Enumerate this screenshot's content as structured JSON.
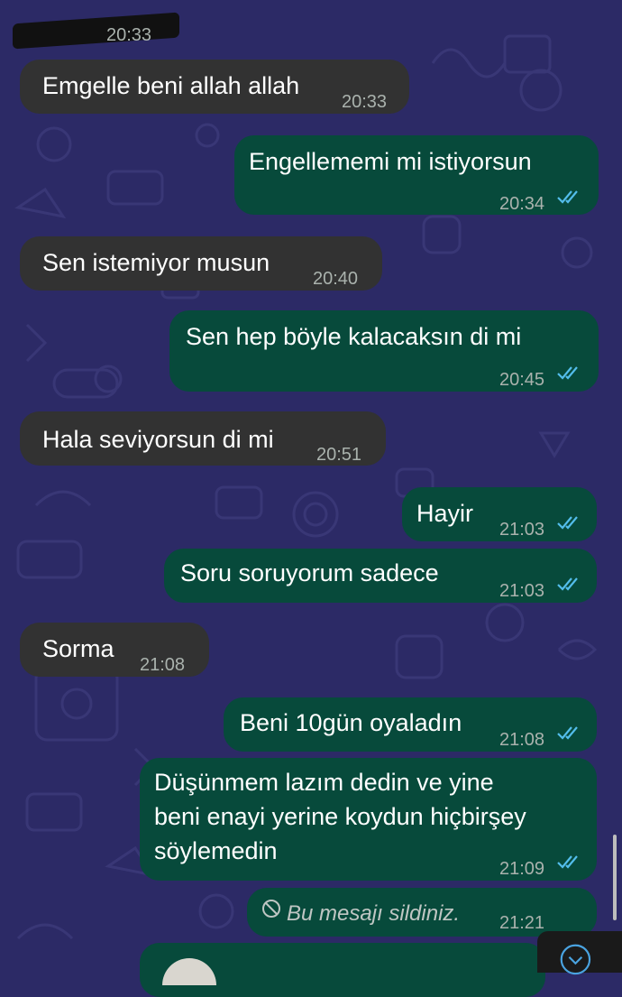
{
  "colors": {
    "wallpaper": "#2c2a66",
    "incoming_bubble": "#323232",
    "outgoing_bubble": "#074a3b",
    "read_ticks": "#53bdeb",
    "timestamp": "#aab2ad"
  },
  "top_partial": {
    "time": "20:33"
  },
  "messages": [
    {
      "dir": "in",
      "text": "Emgelle beni allah allah",
      "time": "20:33"
    },
    {
      "dir": "out",
      "text": "Engellememi mi istiyorsun",
      "time": "20:34",
      "status": "read"
    },
    {
      "dir": "in",
      "text": "Sen istemiyor musun",
      "time": "20:40"
    },
    {
      "dir": "out",
      "text": "Sen hep böyle kalacaksın di mi",
      "time": "20:45",
      "status": "read"
    },
    {
      "dir": "in",
      "text": "Hala seviyorsun di mi",
      "time": "20:51"
    },
    {
      "dir": "out",
      "text": "Hayir",
      "time": "21:03",
      "status": "read"
    },
    {
      "dir": "out",
      "text": "Soru soruyorum sadece",
      "time": "21:03",
      "status": "read"
    },
    {
      "dir": "in",
      "text": "Sorma",
      "time": "21:08"
    },
    {
      "dir": "out",
      "text": "Beni 10gün oyaladın",
      "time": "21:08",
      "status": "read"
    },
    {
      "dir": "out",
      "lines": [
        "Düşünmem lazım dedin ve yine",
        "beni enayi yerine koydun hiçbirşey",
        "söylemedin"
      ],
      "time": "21:09",
      "status": "read"
    },
    {
      "dir": "out",
      "deleted": true,
      "text": "Bu mesajı sildiniz.",
      "time": "21:21",
      "icon": "block-icon"
    }
  ],
  "scroll_button": {
    "icon": "chevron-down-icon"
  }
}
